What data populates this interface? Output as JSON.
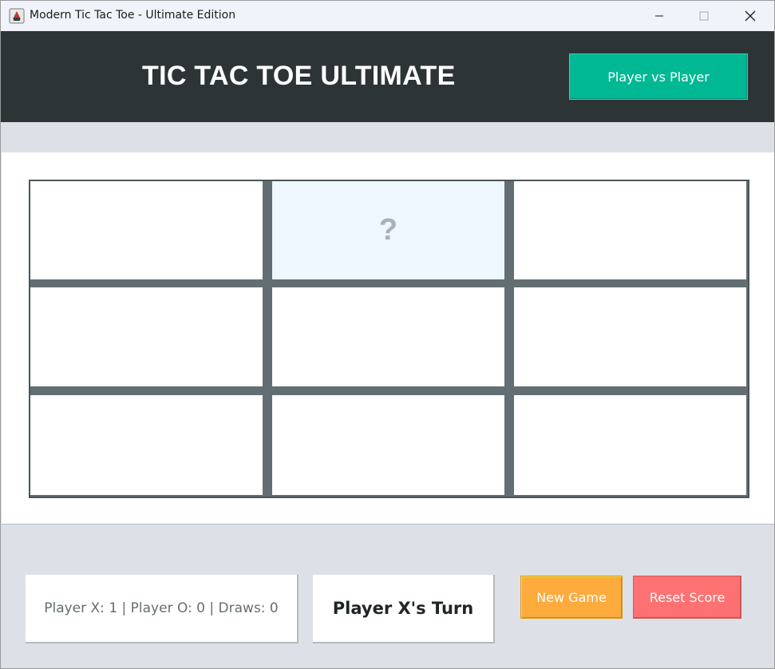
{
  "window": {
    "title": "Modern Tic Tac Toe - Ultimate Edition",
    "icon": "java-app-icon"
  },
  "header": {
    "title": "TIC TAC TOE ULTIMATE",
    "mode_button": "Player vs Player",
    "colors": {
      "background": "#2d3436",
      "mode_button": "#00b894"
    }
  },
  "board": {
    "cells": [
      "",
      "?",
      "",
      "",
      "",
      "",
      "",
      "",
      ""
    ],
    "hover_cell": 1
  },
  "footer": {
    "score": "Player X: 1 | Player O: 0 | Draws: 0",
    "turn": "Player X's Turn",
    "new_game": "New Game",
    "reset_score": "Reset Score",
    "colors": {
      "new_game": "#fdab3d",
      "reset_score": "#fd7172"
    }
  }
}
